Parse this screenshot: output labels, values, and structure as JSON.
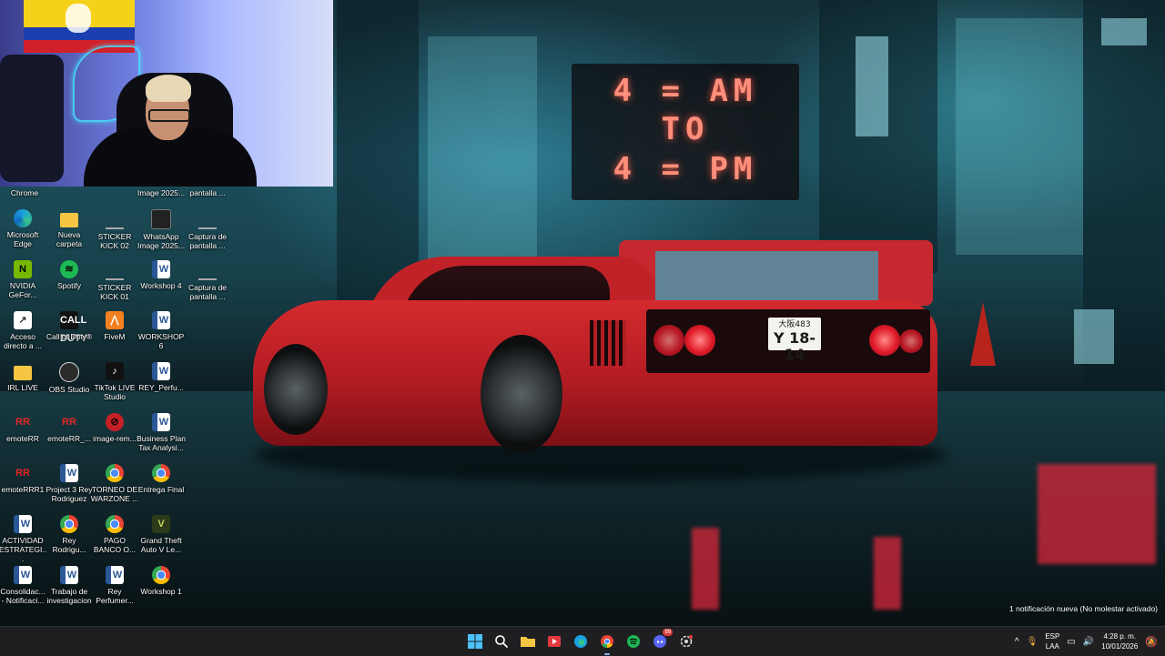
{
  "wallpaper": {
    "sign_lines": [
      "4 = AM",
      "TO",
      "4 = PM"
    ],
    "plate_top": "大阪483",
    "plate_bottom": "Y 18-14"
  },
  "desktop": {
    "partial_top_labels": [
      "Chrome",
      "Image 2025...",
      "pantalla ..."
    ],
    "icons": [
      {
        "label": "Microsoft Edge",
        "icon": "edge-icon"
      },
      {
        "label": "Nueva carpeta",
        "icon": "folder-icon"
      },
      {
        "label": "STICKER KICK 02",
        "icon": "image-icon"
      },
      {
        "label": "WhatsApp Image 2025...",
        "icon": "image-icon"
      },
      {
        "label": "Captura de pantalla ...",
        "icon": "image-icon"
      },
      {
        "label": "NVIDIA GeFor...",
        "icon": "nvidia-icon"
      },
      {
        "label": "Spotify",
        "icon": "spotify-icon"
      },
      {
        "label": "STICKER KICK 01",
        "icon": "image-icon"
      },
      {
        "label": "Workshop 4",
        "icon": "word-icon"
      },
      {
        "label": "Captura de pantalla ...",
        "icon": "image-icon"
      },
      {
        "label": "Acceso directo a ...",
        "icon": "shortcut-icon"
      },
      {
        "label": "Call of Duty®",
        "icon": "call-of-duty-icon"
      },
      {
        "label": "FiveM",
        "icon": "fivem-icon"
      },
      {
        "label": "WORKSHOP 6",
        "icon": "word-icon"
      },
      {
        "label": "IRL LIVE",
        "icon": "folder-icon"
      },
      {
        "label": "OBS Studio",
        "icon": "obs-icon"
      },
      {
        "label": "TikTok LIVE Studio",
        "icon": "tiktok-icon"
      },
      {
        "label": "REY_Perfu...",
        "icon": "word-icon"
      },
      {
        "label": "emoteRR",
        "icon": "rr-icon"
      },
      {
        "label": "emoteRR_...",
        "icon": "rr-icon"
      },
      {
        "label": "image-rem...",
        "icon": "image-icon"
      },
      {
        "label": "Business Plan Tax Analysi...",
        "icon": "word-icon"
      },
      {
        "label": "emoteRRR1",
        "icon": "rr-icon"
      },
      {
        "label": "Project 3 Rey Rodriguez",
        "icon": "word-icon"
      },
      {
        "label": "TORNEO DE WARZONE ...",
        "icon": "chrome-icon"
      },
      {
        "label": "Entrega Final",
        "icon": "chrome-icon"
      },
      {
        "label": "ACTIVIDAD ESTRATEGI...",
        "icon": "word-icon"
      },
      {
        "label": "Rey Rodrigu...",
        "icon": "chrome-icon"
      },
      {
        "label": "PAGO BANCO O...",
        "icon": "chrome-icon"
      },
      {
        "label": "Grand Theft Auto V Le...",
        "icon": "gta-icon"
      },
      {
        "label": "Consolidac... - Notificaci...",
        "icon": "word-icon"
      },
      {
        "label": "Trabajo de investigacion",
        "icon": "word-icon"
      },
      {
        "label": "Rey Perfumer...",
        "icon": "word-icon"
      },
      {
        "label": "Workshop 1",
        "icon": "chrome-icon"
      }
    ]
  },
  "taskbar": {
    "apps": [
      {
        "name": "start-button",
        "icon": "windows-icon"
      },
      {
        "name": "search-button",
        "icon": "search-icon"
      },
      {
        "name": "file-explorer-button",
        "icon": "folder-icon"
      },
      {
        "name": "app-red-button",
        "icon": "red-app-icon"
      },
      {
        "name": "edge-button",
        "icon": "edge-icon"
      },
      {
        "name": "chrome-button",
        "icon": "chrome-icon",
        "active": true
      },
      {
        "name": "spotify-button",
        "icon": "spotify-icon"
      },
      {
        "name": "discord-button",
        "icon": "discord-icon",
        "badge": "99"
      },
      {
        "name": "app-gear-button",
        "icon": "gear-icon"
      }
    ],
    "tray": {
      "lang_line1": "ESP",
      "lang_line2": "LAA",
      "time": "4:28 p. m.",
      "date": "10/01/2026"
    },
    "notification_text": "1 notificación nueva (No molestar activado)"
  }
}
